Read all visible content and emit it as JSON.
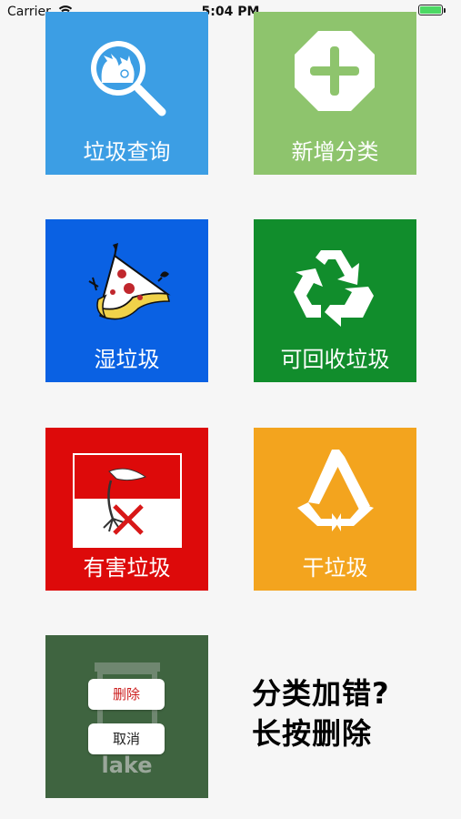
{
  "status_bar": {
    "carrier": "Carrier",
    "time": "5:04 PM",
    "battery_level": 1.0
  },
  "tiles": [
    {
      "label": "垃圾查询",
      "icon": "search-bags-icon",
      "color": "#3c9ee4"
    },
    {
      "label": "新增分类",
      "icon": "plus-octagon-icon",
      "color": "#8ec46d"
    },
    {
      "label": "湿垃圾",
      "icon": "food-waste-icon",
      "color": "#0a61e3"
    },
    {
      "label": "可回收垃圾",
      "icon": "recycle-icon",
      "color": "#118d2c"
    },
    {
      "label": "有害垃圾",
      "icon": "hazardous-icon",
      "color": "#dd0a0a"
    },
    {
      "label": "干垃圾",
      "icon": "dry-waste-icon",
      "color": "#f3a41e"
    },
    {
      "label": "lake",
      "icon": "trash-bin-icon",
      "color": "#3f6440"
    }
  ],
  "context_actions": {
    "delete_label": "删除",
    "cancel_label": "取消"
  },
  "hint": {
    "line1": "分类加错?",
    "line2": "长按删除"
  }
}
